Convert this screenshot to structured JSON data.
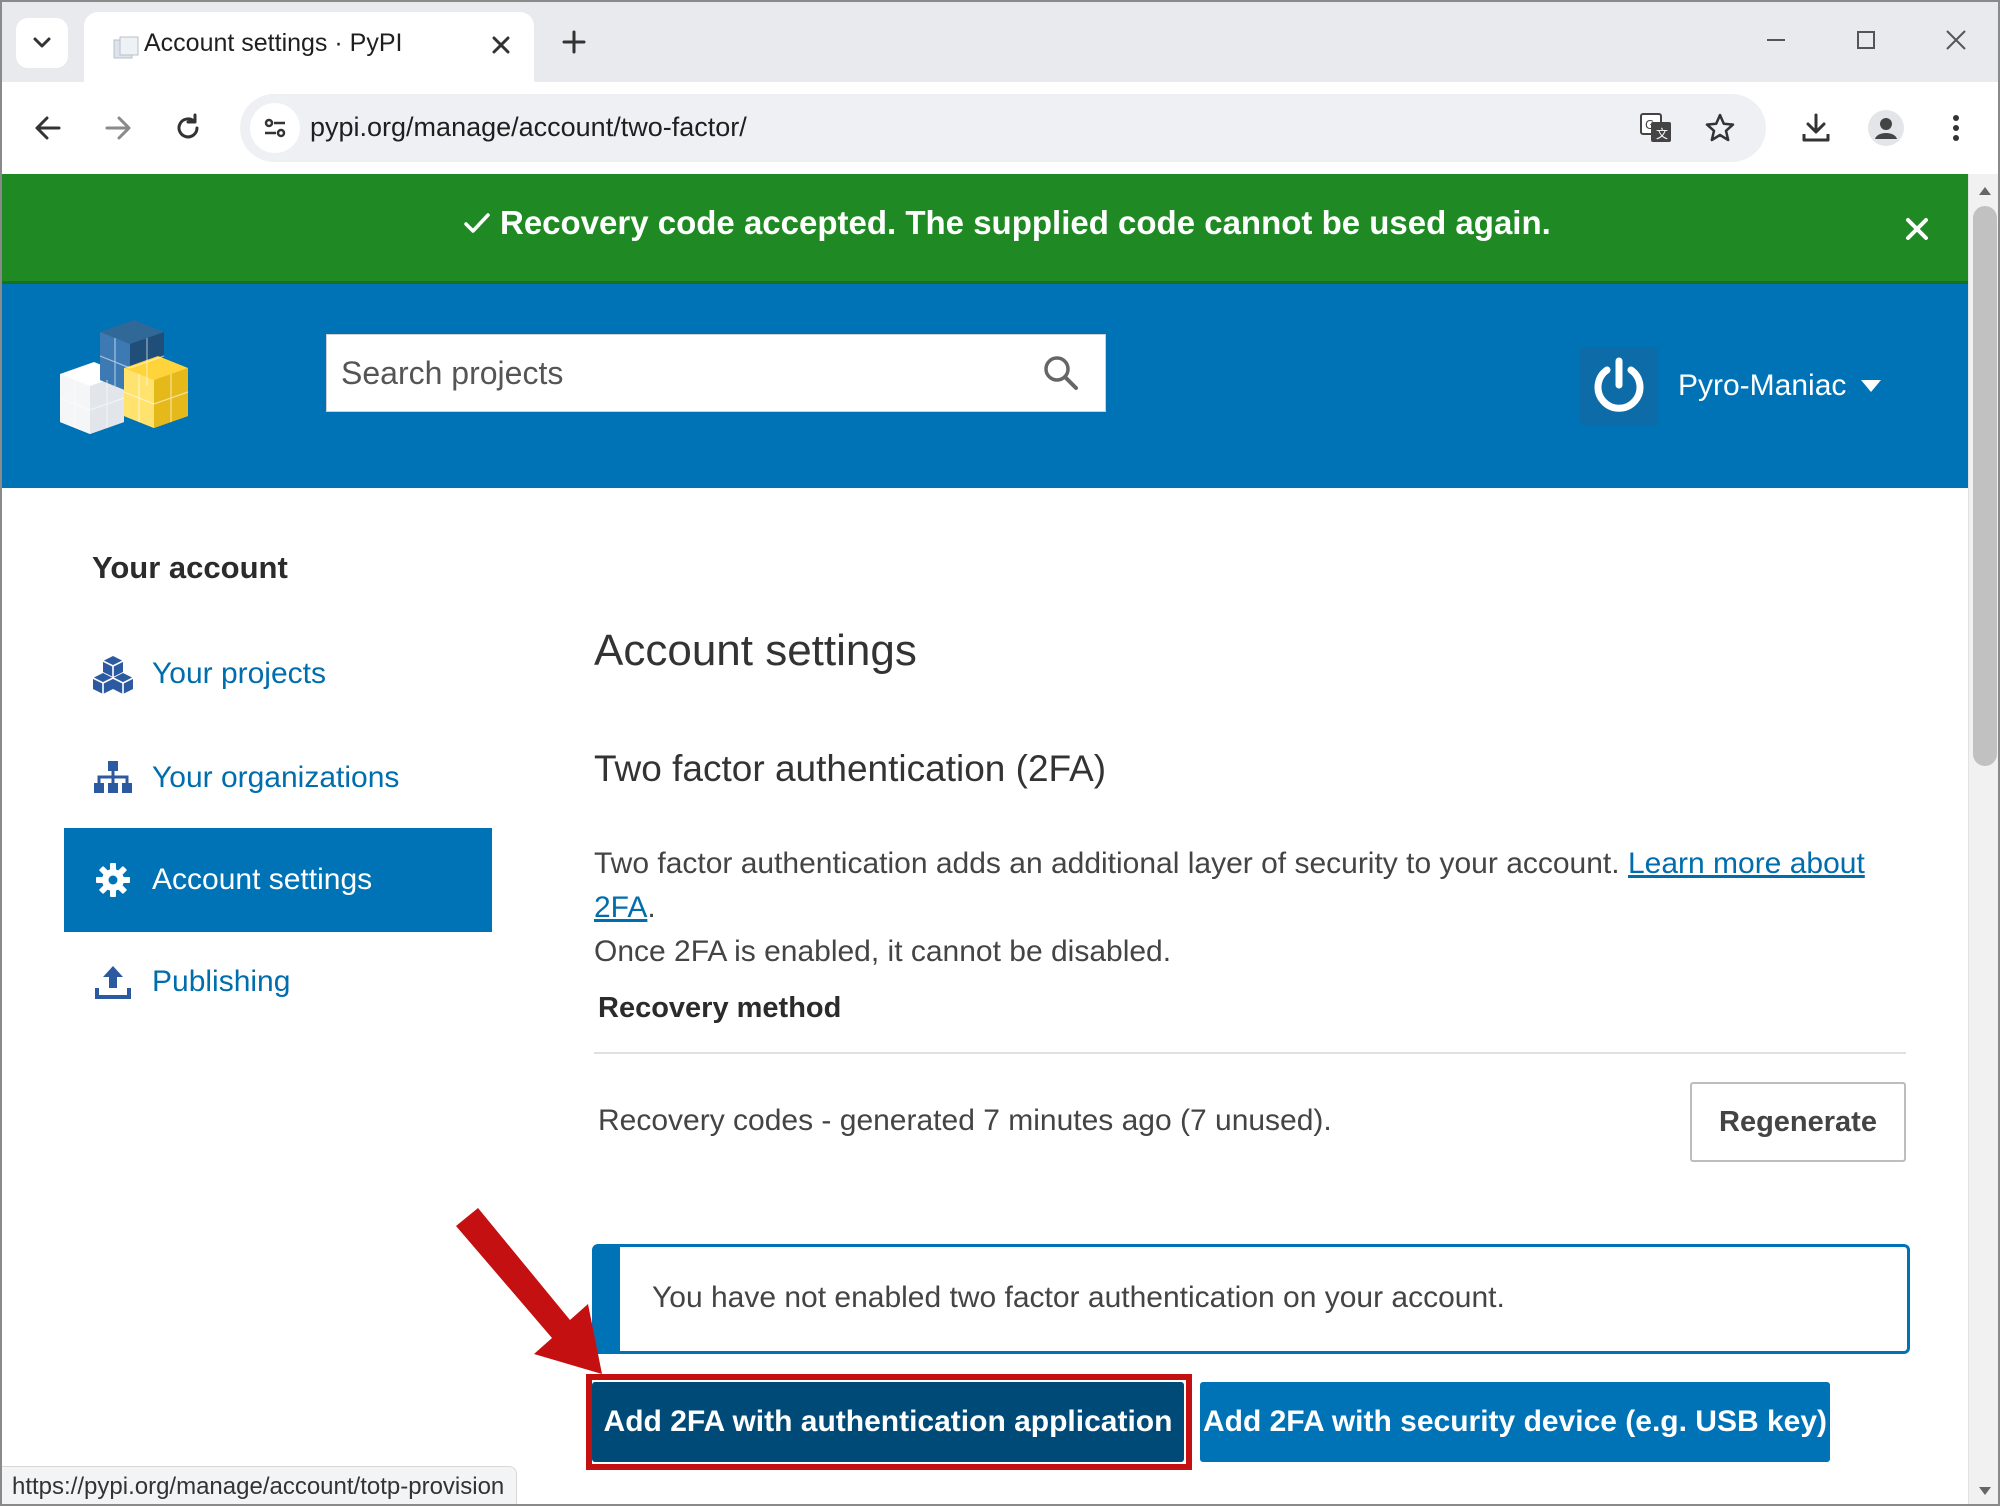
{
  "browser": {
    "tab": {
      "title": "Account settings · PyPI"
    },
    "url": "pypi.org/manage/account/two-factor/",
    "status_url": "https://pypi.org/manage/account/totp-provision"
  },
  "flash": {
    "message": "Recovery code accepted. The supplied code cannot be used again.",
    "color": "#1f8a24"
  },
  "header": {
    "search_placeholder": "Search projects",
    "username": "Pyro-Maniac",
    "color": "#0073b7"
  },
  "sidebar": {
    "title": "Your account",
    "items": [
      {
        "label": "Your projects",
        "icon": "cubes-icon",
        "active": false
      },
      {
        "label": "Your organizations",
        "icon": "sitemap-icon",
        "active": false
      },
      {
        "label": "Account settings",
        "icon": "gear-icon",
        "active": true
      },
      {
        "label": "Publishing",
        "icon": "upload-icon",
        "active": false
      }
    ]
  },
  "main": {
    "title": "Account settings",
    "section_title": "Two factor authentication (2FA)",
    "description_1": "Two factor authentication adds an additional layer of security to your account.",
    "learn_more_link": "Learn more about 2FA",
    "description_2": "Once 2FA is enabled, it cannot be disabled.",
    "recovery_heading": "Recovery method",
    "recovery_text": "Recovery codes - generated 7 minutes ago (7 unused).",
    "regenerate_label": "Regenerate",
    "callout_text": "You have not enabled two factor authentication on your account.",
    "add_app_label": "Add 2FA with authentication application",
    "add_device_label": "Add 2FA with security device (e.g. USB key)"
  },
  "annotation": {
    "color": "#c41010"
  }
}
